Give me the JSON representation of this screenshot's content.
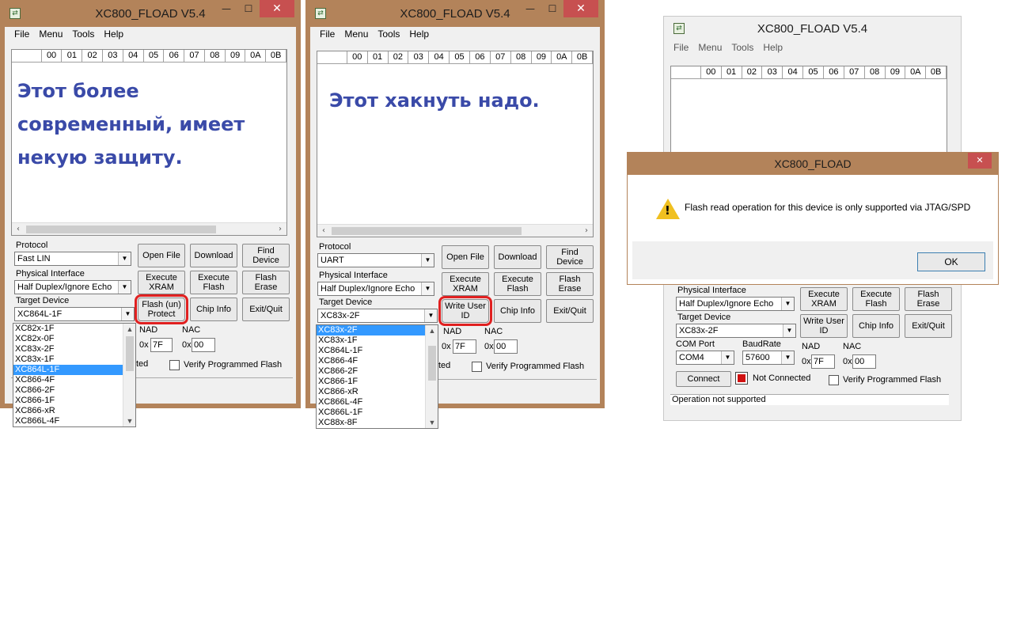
{
  "app": {
    "window_title": "XC800_FLOAD V5.4",
    "menu": [
      "File",
      "Menu",
      "Tools",
      "Help"
    ],
    "hex_columns": [
      "00",
      "01",
      "02",
      "03",
      "04",
      "05",
      "06",
      "07",
      "08",
      "09",
      "0A",
      "0B"
    ],
    "icon_glyph": "⇄",
    "minimize": "—",
    "maximize": "☐",
    "close": "✕",
    "labels": {
      "protocol": "Protocol",
      "physical_interface": "Physical Interface",
      "target_device": "Target Device",
      "com_port": "COM Port",
      "baudrate": "BaudRate",
      "nad": "NAD",
      "nac": "NAC",
      "hex_prefix": "0x",
      "verify": "Verify Programmed Flash",
      "ted": "ted"
    },
    "buttons": {
      "open_file": "Open File",
      "download": "Download",
      "find_device": "Find\nDevice",
      "execute_xram": "Execute\nXRAM",
      "execute_flash": "Execute\nFlash",
      "flash_erase": "Flash\nErase",
      "flash_unprotect": "Flash (un)\nProtect",
      "write_user_id": "Write User\nID",
      "chip_info": "Chip Info",
      "exit_quit": "Exit/Quit",
      "connect": "Connect"
    }
  },
  "window1": {
    "overlay_lines": [
      "Этот более",
      "современный, имеет",
      "некую защиту."
    ],
    "protocol": "Fast LIN",
    "physical_interface": "Half Duplex/Ignore Echo",
    "target_device": "XC864L-1F",
    "nad": "7F",
    "nac": "00",
    "device_list": [
      "XC82x-1F",
      "XC82x-0F",
      "XC83x-2F",
      "XC83x-1F",
      "XC864L-1F",
      "XC866-4F",
      "XC866-2F",
      "XC866-1F",
      "XC866-xR",
      "XC866L-4F"
    ],
    "selected_index": 4
  },
  "window2": {
    "overlay_lines": [
      "Этот хакнуть надо."
    ],
    "protocol": "UART",
    "physical_interface": "Half Duplex/Ignore Echo",
    "target_device": "XC83x-2F",
    "nad": "7F",
    "nac": "00",
    "device_list": [
      "XC83x-2F",
      "XC83x-1F",
      "XC864L-1F",
      "XC866-4F",
      "XC866-2F",
      "XC866-1F",
      "XC866-xR",
      "XC866L-4F",
      "XC866L-1F",
      "XC88x-8F"
    ],
    "selected_index": 0
  },
  "window3": {
    "physical_interface": "Half Duplex/Ignore Echo",
    "target_device": "XC83x-2F",
    "com_port": "COM4",
    "baudrate": "57600",
    "nad": "7F",
    "nac": "00",
    "connection_status": "Not Connected",
    "status_bar": "Operation not supported"
  },
  "dialog": {
    "title": "XC800_FLOAD",
    "message": "Flash read operation for this device is only supported via JTAG/SPD",
    "ok": "OK"
  },
  "colors": {
    "title_bar": "#b3835a",
    "overlay_text": "#3a4aa8",
    "highlight": "#e02020",
    "selection": "#3399ff"
  }
}
